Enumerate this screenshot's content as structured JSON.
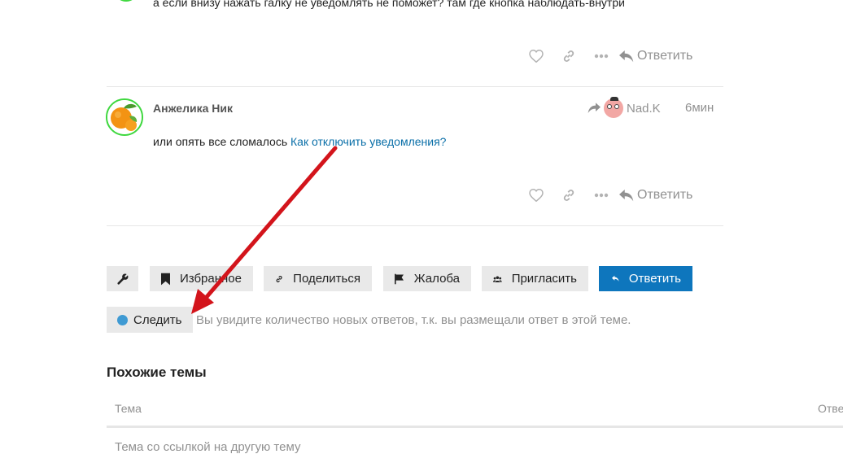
{
  "top_post": {
    "text": "а если внизу нажать галку не уведомлять не поможет? там где кнопка наблюдать-внутри",
    "reply_label": "Ответить"
  },
  "post": {
    "author": "Анжелика Ник",
    "reply_to_user": "Nad.K",
    "time": "6мин",
    "text_prefix": "или опять все сломалось ",
    "link_text": "Как отключить уведомления?",
    "reply_label": "Ответить"
  },
  "topic_buttons": {
    "favorites": "Избранное",
    "share": "Поделиться",
    "flag": "Жалоба",
    "invite": "Пригласить",
    "reply": "Ответить"
  },
  "notifications": {
    "button_label": "Следить",
    "reason": "Вы увидите количество новых ответов, т.к. вы размещали ответ в этой теме."
  },
  "similar_topics": {
    "heading": "Похожие темы",
    "col_topic": "Тема",
    "col_replies": "Отве",
    "first_topic": "Тема со ссылкой на другую тему"
  },
  "colors": {
    "primary": "#0e76bd",
    "link": "#0a6fa8",
    "arrow_annotation": "#d3141b",
    "online_ring": "#3fd83f"
  },
  "icons": [
    "heart-icon",
    "link-icon",
    "ellipsis-icon",
    "reply-icon",
    "wrench-icon",
    "bookmark-icon",
    "flag-icon",
    "users-icon"
  ]
}
